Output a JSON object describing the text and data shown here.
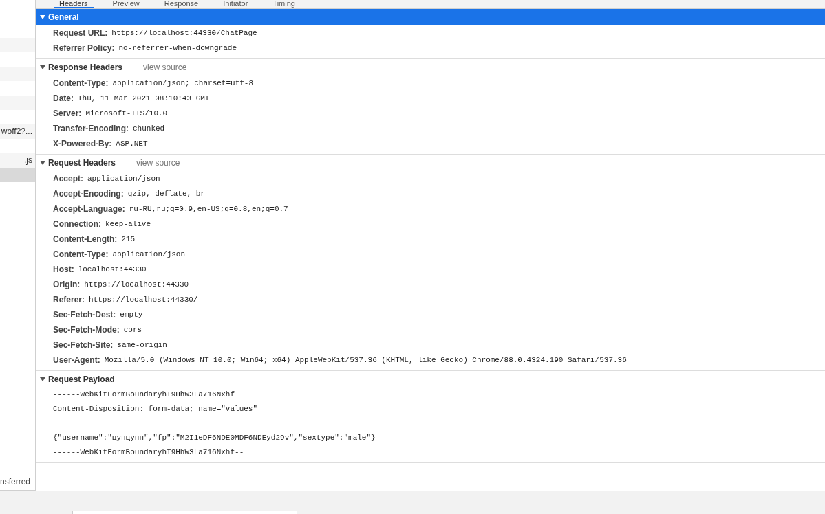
{
  "tabs": [
    {
      "label": "Headers",
      "selected": true
    },
    {
      "label": "Preview",
      "selected": false
    },
    {
      "label": "Response",
      "selected": false
    },
    {
      "label": "Initiator",
      "selected": false
    },
    {
      "label": "Timing",
      "selected": false
    }
  ],
  "request_list": {
    "rows": [
      {
        "selected": false
      },
      {
        "selected": false
      },
      {
        "selected": false
      },
      {
        "selected": false
      },
      {
        "selected": false
      },
      {
        "selected": false
      },
      {
        "selected": false
      },
      {
        "selected": false
      },
      {
        "text": "woff2?...",
        "selected": false
      },
      {
        "selected": false
      },
      {
        "text": ".js",
        "selected": false
      },
      {
        "selected": true
      }
    ],
    "footer": "nsferred"
  },
  "sections": [
    {
      "title": "General",
      "expanded": true,
      "highlighted": true,
      "headers": [
        {
          "name": "Request URL:",
          "value": "https://localhost:44330/ChatPage"
        },
        {
          "name": "Referrer Policy:",
          "value": "no-referrer-when-downgrade"
        }
      ]
    },
    {
      "title": "Response Headers",
      "expanded": true,
      "highlighted": false,
      "link": "view source",
      "headers": [
        {
          "name": "Content-Type:",
          "value": "application/json; charset=utf-8"
        },
        {
          "name": "Date:",
          "value": "Thu, 11 Mar 2021 08:10:43 GMT"
        },
        {
          "name": "Server:",
          "value": "Microsoft-IIS/10.0"
        },
        {
          "name": "Transfer-Encoding:",
          "value": "chunked"
        },
        {
          "name": "X-Powered-By:",
          "value": "ASP.NET"
        }
      ]
    },
    {
      "title": "Request Headers",
      "expanded": true,
      "highlighted": false,
      "link": "view source",
      "headers": [
        {
          "name": "Accept:",
          "value": "application/json"
        },
        {
          "name": "Accept-Encoding:",
          "value": "gzip, deflate, br"
        },
        {
          "name": "Accept-Language:",
          "value": "ru-RU,ru;q=0.9,en-US;q=0.8,en;q=0.7"
        },
        {
          "name": "Connection:",
          "value": "keep-alive"
        },
        {
          "name": "Content-Length:",
          "value": "215"
        },
        {
          "name": "Content-Type:",
          "value": "application/json"
        },
        {
          "name": "Host:",
          "value": "localhost:44330"
        },
        {
          "name": "Origin:",
          "value": "https://localhost:44330"
        },
        {
          "name": "Referer:",
          "value": "https://localhost:44330/"
        },
        {
          "name": "Sec-Fetch-Dest:",
          "value": "empty"
        },
        {
          "name": "Sec-Fetch-Mode:",
          "value": "cors"
        },
        {
          "name": "Sec-Fetch-Site:",
          "value": "same-origin"
        },
        {
          "name": "User-Agent:",
          "value": "Mozilla/5.0 (Windows NT 10.0; Win64; x64) AppleWebKit/537.36 (KHTML, like Gecko) Chrome/88.0.4324.190 Safari/537.36"
        }
      ]
    },
    {
      "title": "Request Payload",
      "expanded": true,
      "highlighted": false,
      "payload": [
        {
          "lines": [
            "------WebKitFormBoundaryhT9HhW3La716Nxhf",
            "Content-Disposition: form-data; name=\"values\""
          ]
        },
        {
          "lines": [
            "{\"username\":\"цупцупп\",\"fp\":\"M2I1eDF6NDE0MDF6NDEyd29v\",\"sextype\":\"male\"}",
            "------WebKitFormBoundaryhT9HhW3La716Nxhf--"
          ]
        }
      ]
    }
  ]
}
